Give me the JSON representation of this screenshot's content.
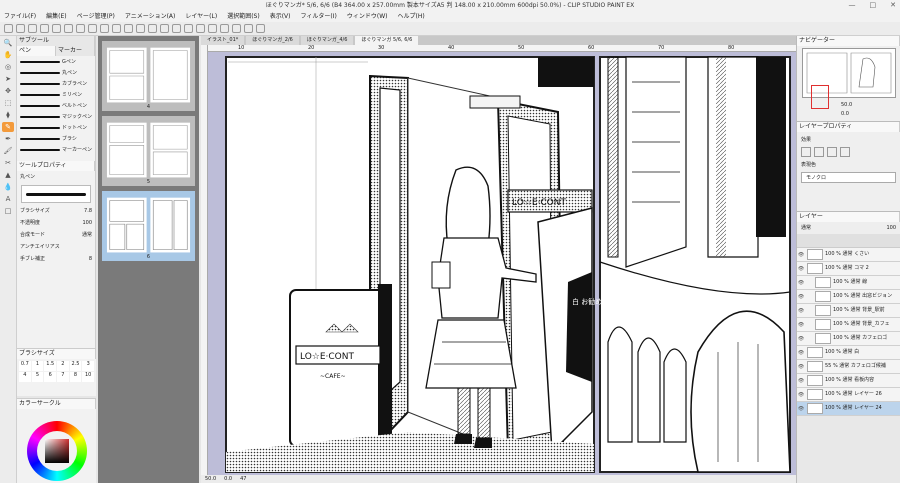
{
  "window": {
    "title": "ほぐりマンガ* 5/6, 6/6 (B4 364.00 x 257.00mm 製本サイズA5 判 148.00 x 210.00mm 600dpi 50.0%) - CLIP STUDIO PAINT EX",
    "min": "—",
    "max": "□",
    "close": "✕"
  },
  "menu": [
    "ファイル(F)",
    "編集(E)",
    "ページ管理(P)",
    "アニメーション(A)",
    "レイヤー(L)",
    "選択範囲(S)",
    "表示(V)",
    "フィルター(I)",
    "ウィンドウ(W)",
    "ヘルプ(H)"
  ],
  "tools": [
    "🔍",
    "✋",
    "◎",
    "➤",
    "✥",
    "⬚",
    "⧫",
    "✎",
    "✒",
    "🖌",
    "✂",
    "▲",
    "💧",
    "A",
    "□"
  ],
  "subtool": {
    "tab1": "サブツール",
    "tab2": "ペン",
    "tab3": "マーカー",
    "brushes": [
      "Gペン",
      "丸ペン",
      "カブラペン",
      "ミリペン",
      "ベルトペン",
      "マジックペン",
      "ドットペン",
      "ブラシ",
      "マーカーペン"
    ]
  },
  "toolprop": {
    "title": "ツールプロパティ",
    "name": "丸ペン",
    "props": [
      {
        "label": "ブラシサイズ",
        "value": "7.8"
      },
      {
        "label": "不透明度",
        "value": "100"
      },
      {
        "label": "合成モード",
        "value": "通常"
      },
      {
        "label": "アンチエイリアス",
        "value": ""
      },
      {
        "label": "手ブレ補正",
        "value": "8"
      }
    ]
  },
  "brushsize": {
    "title": "ブラシサイズ",
    "sizes": [
      "0.7",
      "1",
      "1.5",
      "2",
      "2.5",
      "3",
      "4",
      "5",
      "6",
      "7",
      "8",
      "10"
    ]
  },
  "colorpanel": {
    "title": "カラーサークル"
  },
  "pages": [
    {
      "num": "4"
    },
    {
      "num": "5"
    },
    {
      "num": "6"
    }
  ],
  "doctabs": [
    "イラスト_01*",
    "ほぐりマンガ_2/6",
    "ほぐりマンガ_4/6",
    "ほぐりマンガ 5/6, 6/6"
  ],
  "ruler": [
    "10",
    "20",
    "30",
    "40",
    "50",
    "60",
    "70",
    "80"
  ],
  "status": {
    "zoom": "50.0",
    "angle": "0.0",
    "pos": "47"
  },
  "art": {
    "sign_top": "LO☆E·CONT",
    "sign_front": "LO☆E·CONT",
    "sign_sub": "~CAFE~",
    "board": "白 お勧め"
  },
  "navigator": {
    "title": "ナビゲーター",
    "zoom": "50.0",
    "angle": "0.0"
  },
  "layerprop": {
    "title": "レイヤープロパティ",
    "effect": "効果",
    "expression": "表現色",
    "mono": "モノクロ"
  },
  "layers": {
    "title": "レイヤー",
    "blend": "通常",
    "opacity": "100",
    "rows": [
      {
        "name": "100 % 通常 くさい",
        "sel": false
      },
      {
        "name": "100 % 通常 コマ 2",
        "sel": false
      },
      {
        "name": "100 % 通常 線",
        "sel": false
      },
      {
        "name": "100 % 通常 出窓ビジョン",
        "sel": false
      },
      {
        "name": "100 % 通常 背景_駅前",
        "sel": false
      },
      {
        "name": "100 % 通常 背景_カフェ",
        "sel": false
      },
      {
        "name": "100 % 通常 カフェロゴ",
        "sel": false
      },
      {
        "name": "100 % 通常 白",
        "sel": false
      },
      {
        "name": "55 % 通常 カフェロゴ候補",
        "sel": false
      },
      {
        "name": "100 % 通常 看板内容",
        "sel": false
      },
      {
        "name": "100 % 通常 レイヤー 26",
        "sel": false
      },
      {
        "name": "100 % 通常 レイヤー 24",
        "sel": true
      }
    ]
  }
}
